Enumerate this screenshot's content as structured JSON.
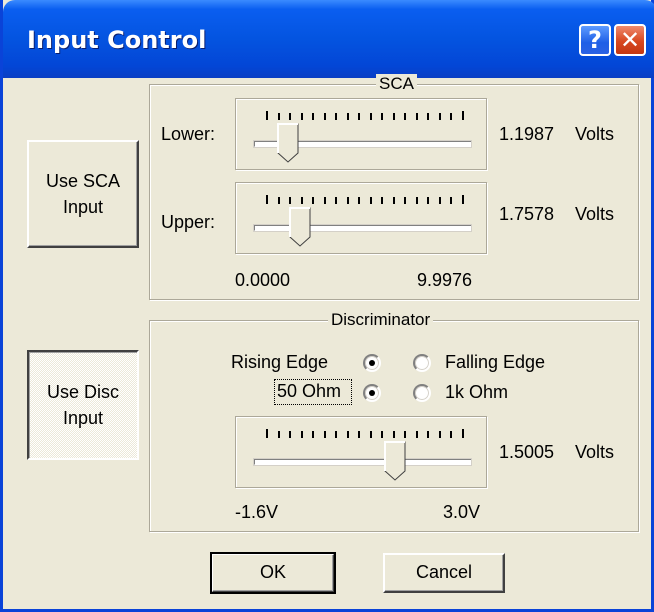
{
  "window": {
    "title": "Input Control",
    "help_glyph": "?",
    "close_glyph": "✕"
  },
  "sca": {
    "legend": "SCA",
    "lower_label": "Lower:",
    "upper_label": "Upper:",
    "lower_value": "1.1987",
    "upper_value": "1.7578",
    "unit": "Volts",
    "range_min": "0.0000",
    "range_max": "9.9976",
    "lower_fraction": 0.12,
    "upper_fraction": 0.18
  },
  "use_sca_button": {
    "label_line1": "Use SCA",
    "label_line2": "Input",
    "pressed": false
  },
  "use_disc_button": {
    "label_line1": "Use Disc",
    "label_line2": "Input",
    "pressed": true
  },
  "discriminator": {
    "legend": "Discriminator",
    "rising_edge": "Rising Edge",
    "falling_edge": "Falling Edge",
    "fifty_ohm": "50 Ohm",
    "one_k_ohm": "1k Ohm",
    "edge_selected": "rising",
    "impedance_selected": "50",
    "value": "1.5005",
    "unit": "Volts",
    "range_min": "-1.6V",
    "range_max": "3.0V",
    "fraction": 0.67
  },
  "buttons": {
    "ok": "OK",
    "cancel": "Cancel"
  },
  "colors": {
    "titlebar": "#0454e0",
    "face": "#ece9d8",
    "close": "#d8481f"
  },
  "icons": {
    "help": "help-icon",
    "close": "close-icon"
  }
}
